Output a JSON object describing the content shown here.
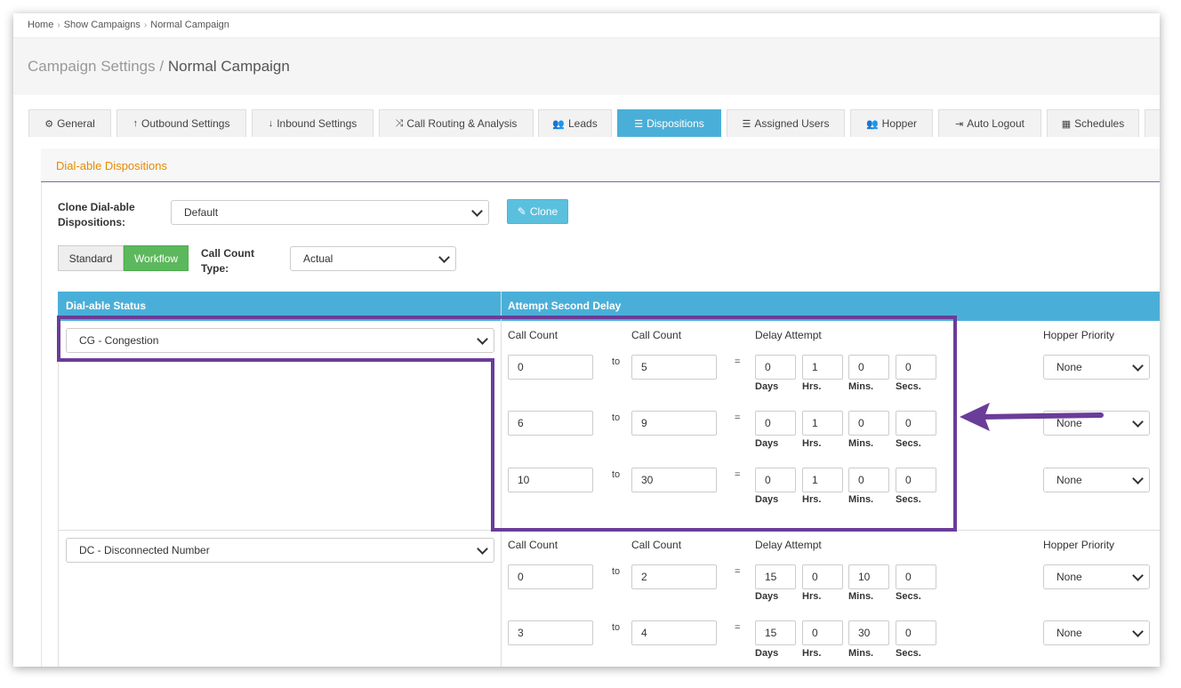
{
  "breadcrumb": {
    "home": "Home",
    "campaigns": "Show Campaigns",
    "current": "Normal Campaign"
  },
  "page": {
    "section": "Campaign Settings",
    "separator": "/",
    "name": "Normal Campaign"
  },
  "tabs": [
    {
      "label": "General",
      "icon": "gears-icon",
      "glyph": "⚙"
    },
    {
      "label": "Outbound Settings",
      "icon": "arrow-up-icon",
      "glyph": "↑"
    },
    {
      "label": "Inbound Settings",
      "icon": "arrow-down-icon",
      "glyph": "↓"
    },
    {
      "label": "Call Routing & Analysis",
      "icon": "random-icon",
      "glyph": "⤨"
    },
    {
      "label": "Leads",
      "icon": "users-icon",
      "glyph": "👥"
    },
    {
      "label": "Dispositions",
      "icon": "list-icon",
      "glyph": "☰"
    },
    {
      "label": "Assigned Users",
      "icon": "list-ol-icon",
      "glyph": "☰"
    },
    {
      "label": "Hopper",
      "icon": "users-icon",
      "glyph": "👥"
    },
    {
      "label": "Auto Logout",
      "icon": "sign-out-icon",
      "glyph": "⇥"
    },
    {
      "label": "Schedules",
      "icon": "calendar-icon",
      "glyph": "▦"
    }
  ],
  "panel": {
    "title": "Dial-able Dispositions"
  },
  "clone": {
    "label": "Clone Dial-able Dispositions:",
    "select_value": "Default",
    "button": "Clone",
    "button_icon": "edit-icon"
  },
  "mode": {
    "standard": "Standard",
    "workflow": "Workflow",
    "count_type_label": "Call Count Type:",
    "count_type_value": "Actual"
  },
  "table": {
    "col_status": "Dial-able Status",
    "col_delay": "Attempt Second Delay",
    "labels": {
      "call_count": "Call Count",
      "delay_attempt": "Delay Attempt",
      "hopper_priority": "Hopper Priority",
      "to": "to",
      "equals": "=",
      "days": "Days",
      "hrs": "Hrs.",
      "mins": "Mins.",
      "secs": "Secs."
    },
    "groups": [
      {
        "status": "CG - Congestion",
        "rows": [
          {
            "from": "0",
            "to": "5",
            "days": "0",
            "hrs": "1",
            "mins": "0",
            "secs": "0",
            "priority": "None"
          },
          {
            "from": "6",
            "to": "9",
            "days": "0",
            "hrs": "1",
            "mins": "0",
            "secs": "0",
            "priority": "None"
          },
          {
            "from": "10",
            "to": "30",
            "days": "0",
            "hrs": "1",
            "mins": "0",
            "secs": "0",
            "priority": "None"
          }
        ]
      },
      {
        "status": "DC - Disconnected Number",
        "rows": [
          {
            "from": "0",
            "to": "2",
            "days": "15",
            "hrs": "0",
            "mins": "10",
            "secs": "0",
            "priority": "None"
          },
          {
            "from": "3",
            "to": "4",
            "days": "15",
            "hrs": "0",
            "mins": "30",
            "secs": "0",
            "priority": "None"
          }
        ]
      }
    ]
  },
  "annotation": {
    "color": "#6a3d99"
  }
}
